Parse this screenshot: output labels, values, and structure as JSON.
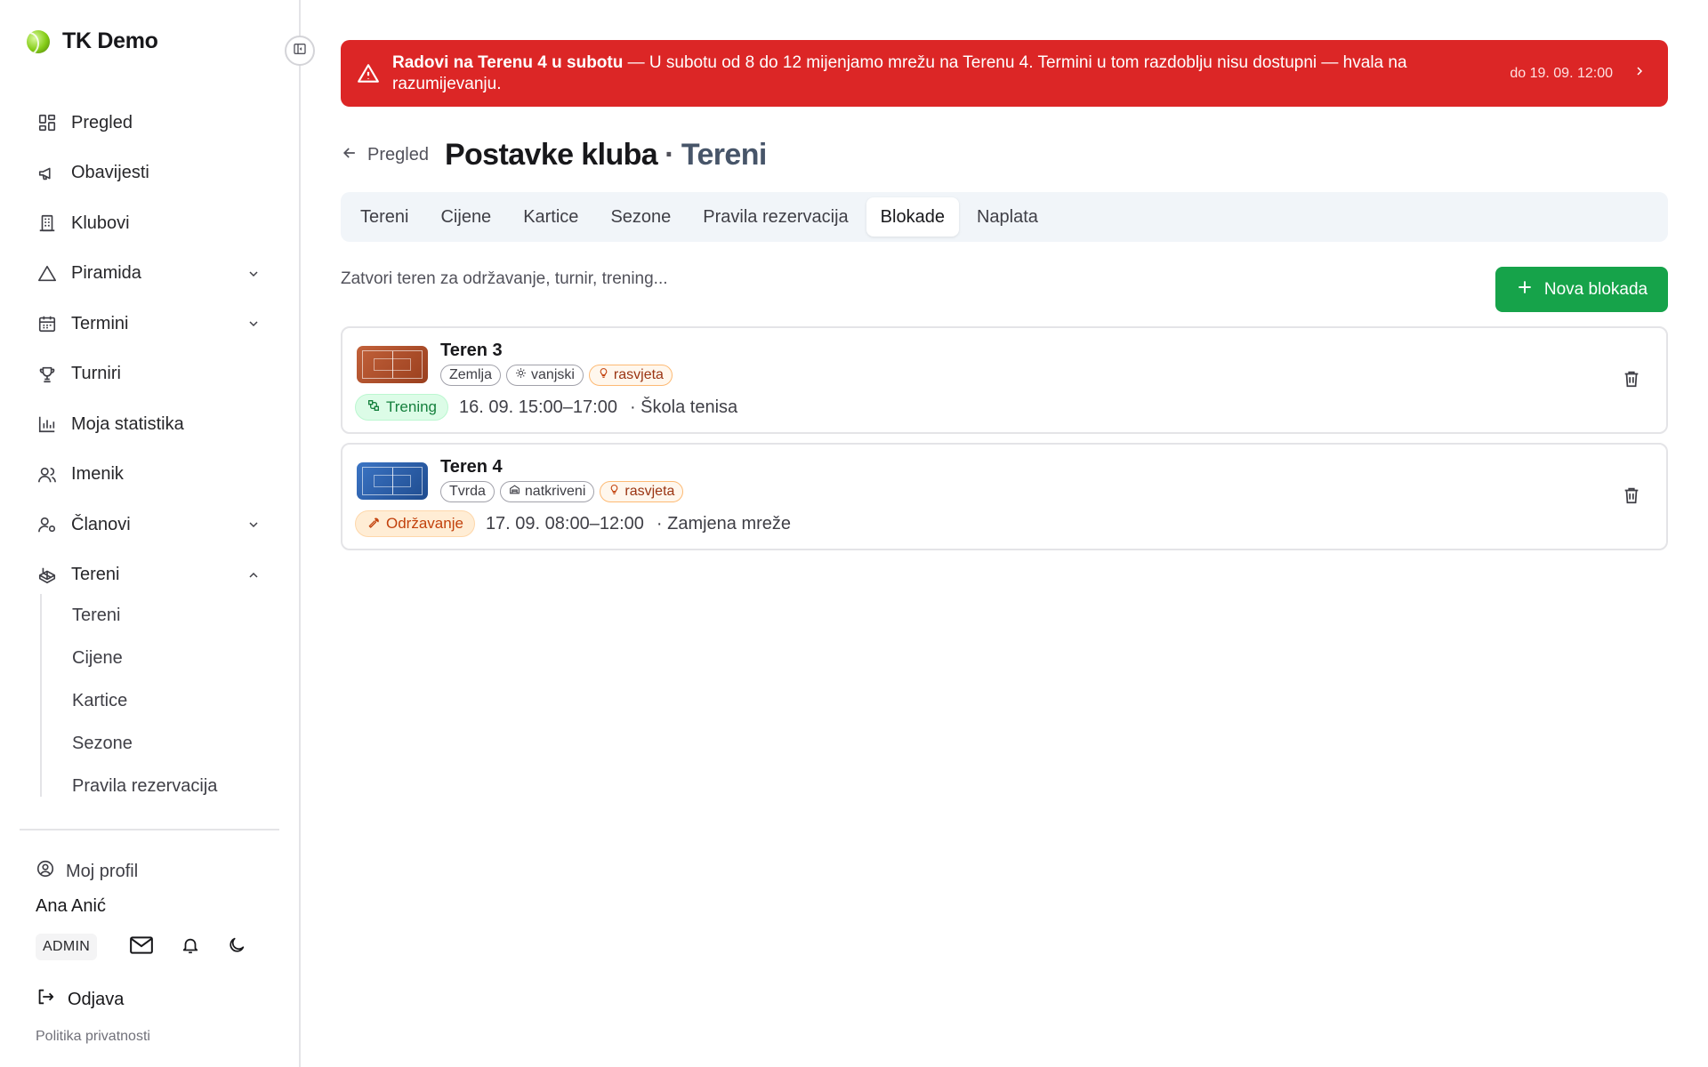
{
  "app": {
    "name": "TK Demo"
  },
  "sidebar": {
    "items": [
      {
        "label": "Pregled",
        "icon": "dashboard-icon"
      },
      {
        "label": "Obavijesti",
        "icon": "megaphone-icon"
      },
      {
        "label": "Klubovi",
        "icon": "building-icon"
      },
      {
        "label": "Piramida",
        "icon": "triangle-icon"
      },
      {
        "label": "Termini",
        "icon": "calendar-icon"
      },
      {
        "label": "Turniri",
        "icon": "trophy-icon"
      },
      {
        "label": "Moja statistika",
        "icon": "bar-chart-icon"
      },
      {
        "label": "Imenik",
        "icon": "users-icon"
      },
      {
        "label": "Članovi",
        "icon": "user-cog-icon"
      },
      {
        "label": "Tereni",
        "icon": "court-icon"
      }
    ],
    "subitems": [
      "Tereni",
      "Cijene",
      "Kartice",
      "Sezone",
      "Pravila rezervacija"
    ],
    "profile_label": "Moj profil",
    "user_name": "Ana Anić",
    "role": "ADMIN",
    "logout_label": "Odjava",
    "privacy_label": "Politika privatnosti"
  },
  "banner": {
    "title": "Radovi na Terenu 4 u subotu",
    "message": " — U subotu od 8 do 12 mijenjamo mrežu na Terenu 4. Termini u tom razdoblju nisu dostupni — hvala na razumijevanju.",
    "until": "do 19. 09. 12:00",
    "color": "#dc2626"
  },
  "header": {
    "back_label": "Pregled",
    "title": "Postavke kluba",
    "separator": "·",
    "subtitle": "Tereni"
  },
  "tabs": [
    "Tereni",
    "Cijene",
    "Kartice",
    "Sezone",
    "Pravila rezervacija",
    "Blokade",
    "Naplata"
  ],
  "active_tab": "Blokade",
  "intro": "Zatvori teren za održavanje, turnir, trening...",
  "new_button_label": "Nova blokada",
  "blocks": [
    {
      "court": "Teren 3",
      "surface": "Zemlja",
      "location": "vanjski",
      "light": "rasvjeta",
      "type": "Trening",
      "time": "16. 09. 15:00–17:00",
      "note": "· Škola tenisa",
      "court_color": "#b4532a"
    },
    {
      "court": "Teren 4",
      "surface": "Tvrda",
      "location": "natkriveni",
      "light": "rasvjeta",
      "type": "Održavanje",
      "time": "17. 09. 08:00–12:00",
      "note": "· Zamjena mreže",
      "court_color": "#2a5ea8"
    }
  ],
  "colors": {
    "accent": "#16a34a",
    "danger": "#dc2626"
  }
}
